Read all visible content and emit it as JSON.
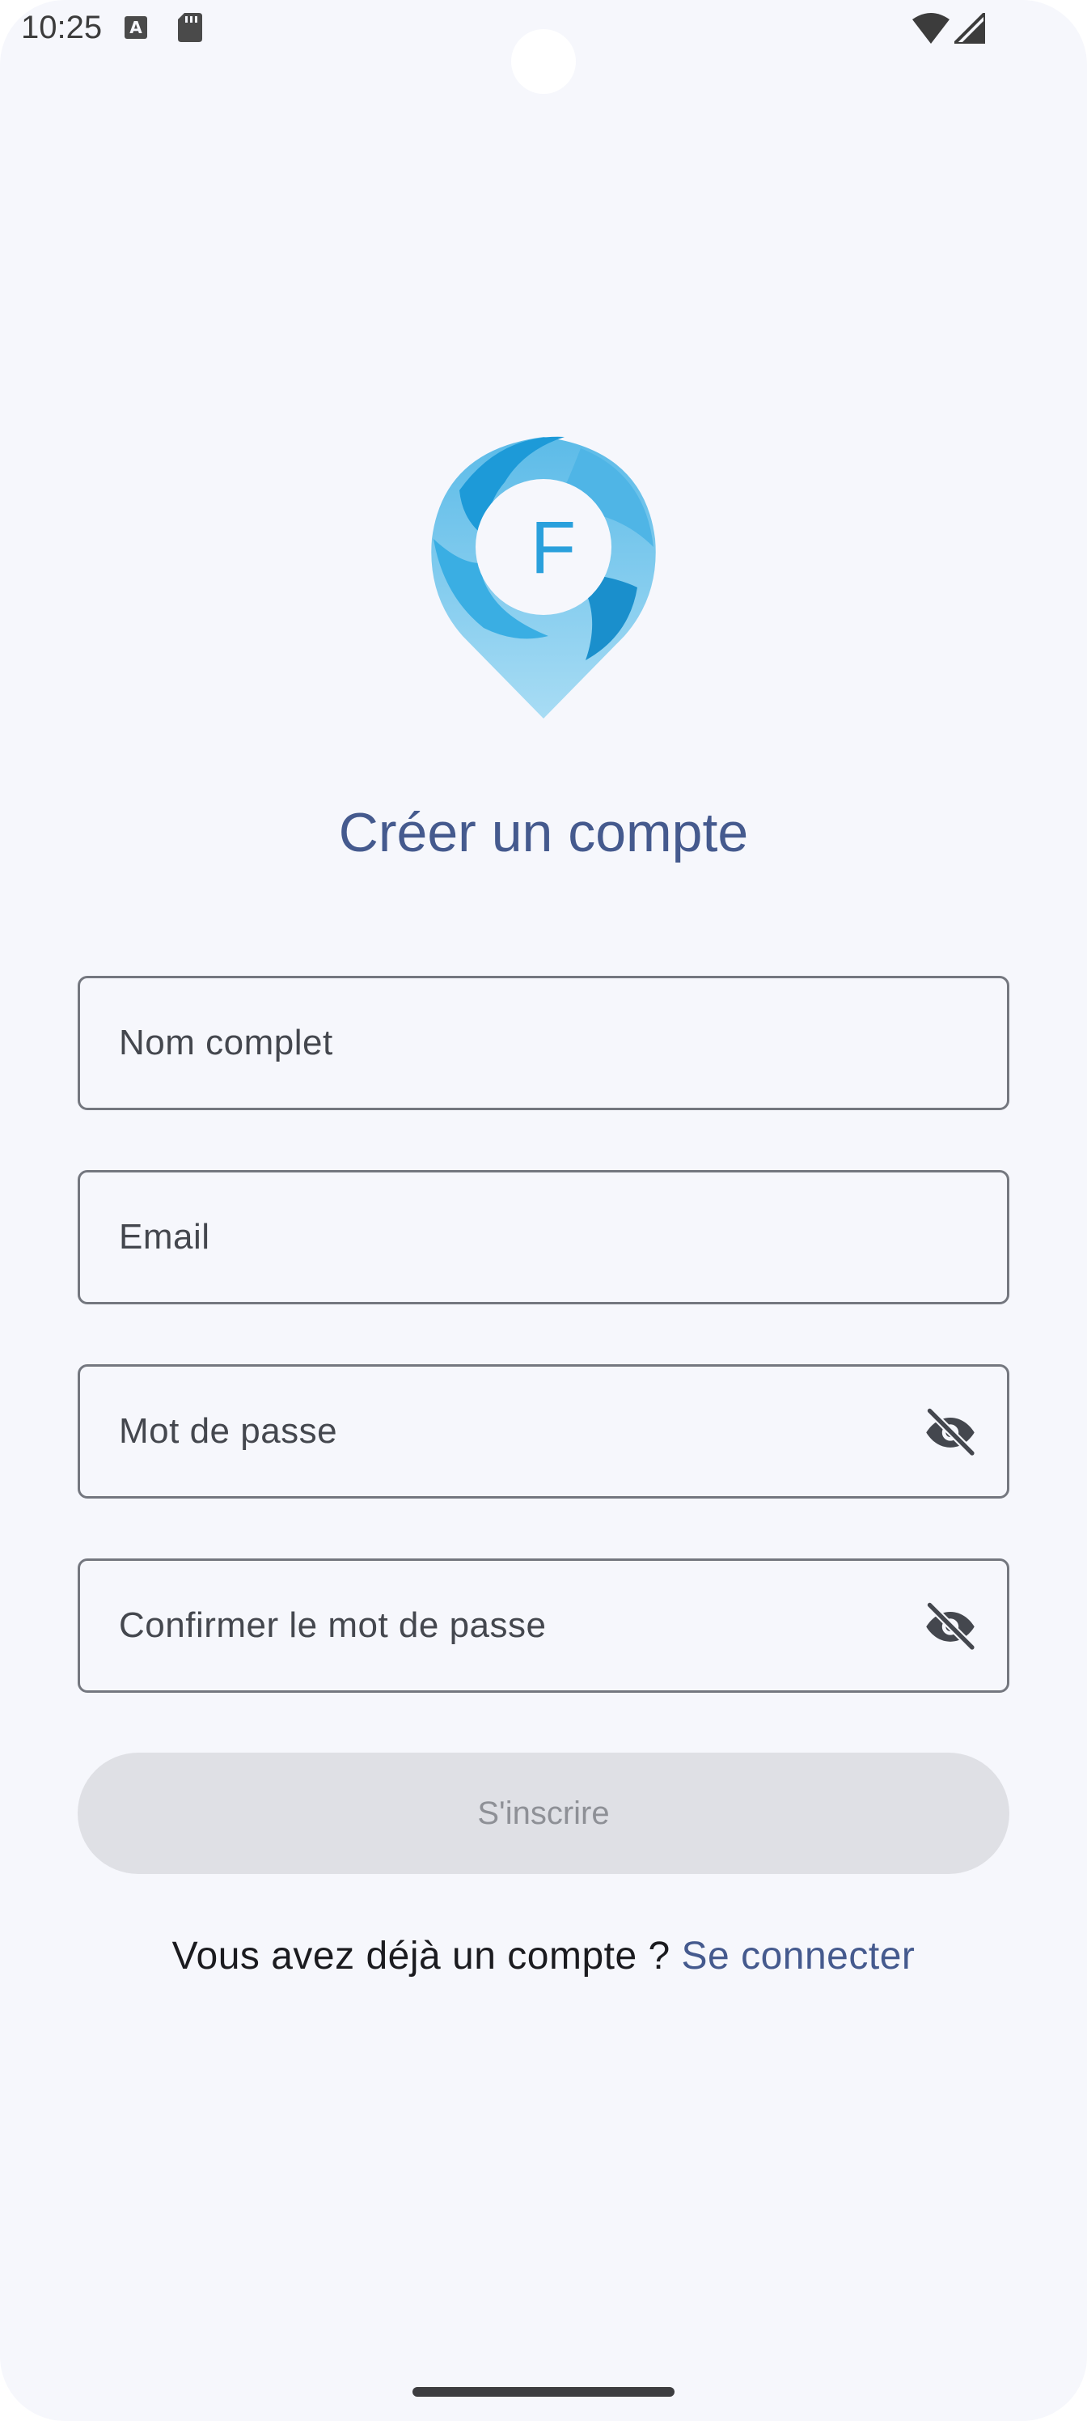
{
  "status_bar": {
    "time": "10:25",
    "icons": [
      "keyboard-a-icon",
      "sd-card-icon",
      "wifi-icon",
      "signal-icon"
    ]
  },
  "logo": {
    "letter": "F",
    "colors": {
      "primary": "#29a3e0",
      "light": "#8fd0f0"
    }
  },
  "form": {
    "title": "Créer un compte",
    "fields": {
      "full_name": {
        "label": "Nom complet"
      },
      "email": {
        "label": "Email"
      },
      "password": {
        "label": "Mot de passe",
        "toggle_icon": "eye-off-icon"
      },
      "confirm_password": {
        "label": "Confirmer le mot de passe",
        "toggle_icon": "eye-off-icon"
      }
    },
    "submit_label": "S'inscrire",
    "login_prompt": "Vous avez déjà un compte ? ",
    "login_link": "Se connecter"
  },
  "colors": {
    "background": "#f6f7fc",
    "accent": "#455a8e",
    "outline": "#74777f",
    "disabled_button": "#dfe0e5"
  }
}
